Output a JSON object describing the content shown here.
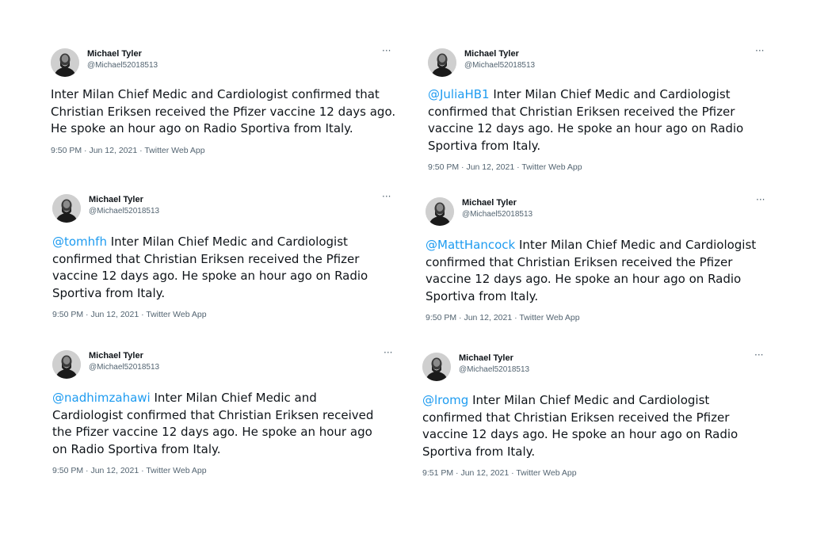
{
  "colors": {
    "mention": "#1d9bf0",
    "secondary_text": "#536471",
    "primary_text": "#0f1419"
  },
  "icons": {
    "more": "more-options-icon",
    "avatar": "profile-avatar"
  },
  "tweets": [
    {
      "author": "Michael Tyler",
      "handle": "@Michael52018513",
      "more": "···",
      "mention": "",
      "text": "Inter Milan Chief Medic and Cardiologist confirmed that Christian Eriksen received the Pfizer vaccine 12 days ago. He spoke an hour ago on Radio Sportiva from Italy.",
      "time": "9:50 PM",
      "date": "Jun 12, 2021",
      "source": "Twitter Web App",
      "sep": "·"
    },
    {
      "author": "Michael Tyler",
      "handle": "@Michael52018513",
      "more": "···",
      "mention": "@JuliaHB1",
      "text": " Inter Milan Chief Medic and Cardiologist confirmed that Christian Eriksen received the Pfizer vaccine 12 days ago. He spoke an hour ago on Radio Sportiva from Italy.",
      "time": "9:50 PM",
      "date": "Jun 12, 2021",
      "source": "Twitter Web App",
      "sep": "·"
    },
    {
      "author": "Michael Tyler",
      "handle": "@Michael52018513",
      "more": "···",
      "mention": "@tomhfh",
      "text": " Inter Milan Chief Medic and Cardiologist confirmed that Christian Eriksen received the Pfizer vaccine 12 days ago. He spoke an hour ago on Radio Sportiva from Italy.",
      "time": "9:50 PM",
      "date": "Jun 12, 2021",
      "source": "Twitter Web App",
      "sep": "·"
    },
    {
      "author": "Michael Tyler",
      "handle": "@Michael52018513",
      "more": "···",
      "mention": "@MattHancock",
      "text": " Inter Milan Chief Medic and Cardiologist confirmed that Christian Eriksen received the Pfizer vaccine 12 days ago. He spoke an hour ago on Radio Sportiva from Italy.",
      "time": "9:50 PM",
      "date": "Jun 12, 2021",
      "source": "Twitter Web App",
      "sep": "·"
    },
    {
      "author": "Michael Tyler",
      "handle": "@Michael52018513",
      "more": "···",
      "mention": "@nadhimzahawi",
      "text": " Inter Milan Chief Medic and Cardiologist confirmed that Christian Eriksen received the Pfizer vaccine 12 days ago. He spoke an hour ago on Radio Sportiva from Italy.",
      "time": "9:50 PM",
      "date": "Jun 12, 2021",
      "source": "Twitter Web App",
      "sep": "·"
    },
    {
      "author": "Michael Tyler",
      "handle": "@Michael52018513",
      "more": "···",
      "mention": "@lromg",
      "text": " Inter Milan Chief Medic and Cardiologist confirmed that Christian Eriksen received the Pfizer vaccine 12 days ago. He spoke an hour ago on Radio Sportiva from Italy.",
      "time": "9:51 PM",
      "date": "Jun 12, 2021",
      "source": "Twitter Web App",
      "sep": "·"
    }
  ]
}
